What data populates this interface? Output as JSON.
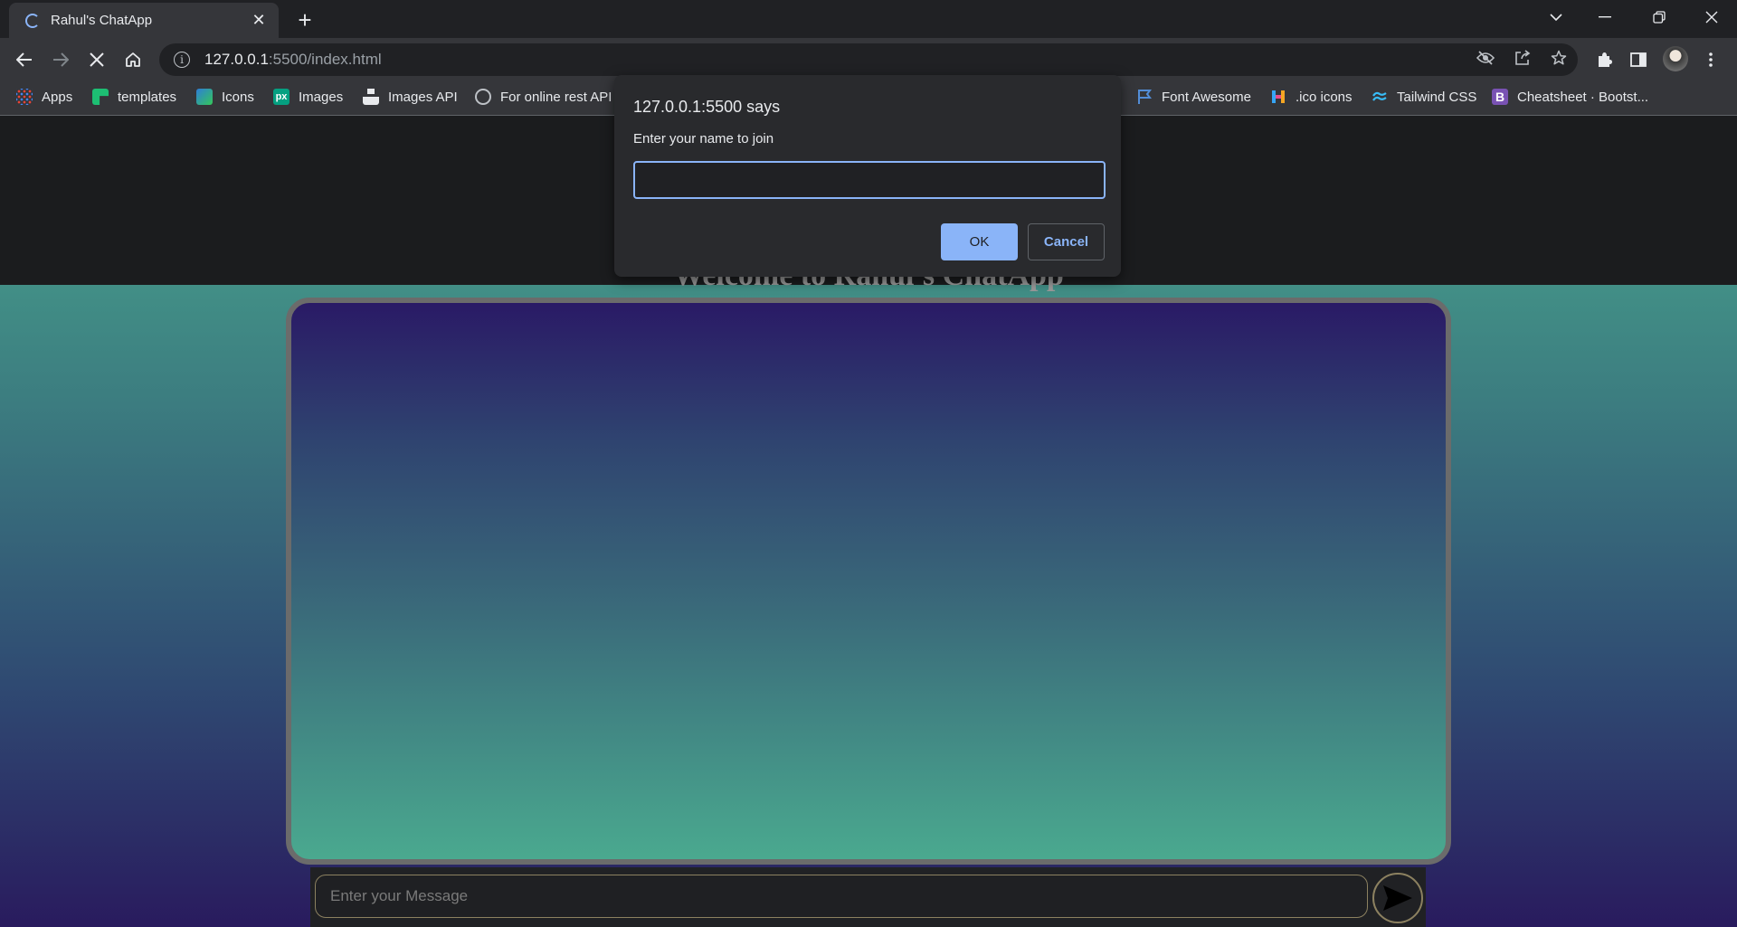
{
  "browser": {
    "tab": {
      "title": "Rahul's ChatApp",
      "favicon": "loading-spinner-icon",
      "close_glyph": "✕"
    },
    "new_tab_glyph": "+",
    "window_controls": [
      "chevron-down-icon",
      "minimize-icon",
      "restore-icon",
      "close-icon"
    ],
    "address_bar": {
      "host": "127.0.0.1",
      "path": ":5500/index.html",
      "info_icon": "info-icon"
    },
    "accent_color": "#8ab4f8"
  },
  "bookmarks": [
    {
      "label": "Apps",
      "icon": "apps-grid-icon"
    },
    {
      "label": "templates",
      "icon": "templates-icon"
    },
    {
      "label": "Icons",
      "icon": "icons-site-icon"
    },
    {
      "label": "Images",
      "icon": "pexels-icon"
    },
    {
      "label": "Images API",
      "icon": "unsplash-icon"
    },
    {
      "label": "For online rest API",
      "icon": "rest-api-icon"
    },
    {
      "label": "Font Awesome",
      "icon": "flag-icon"
    },
    {
      "label": ".ico icons",
      "icon": "ico-icon"
    },
    {
      "label": "Tailwind CSS",
      "icon": "tailwind-icon"
    },
    {
      "label": "Cheatsheet · Bootst...",
      "icon": "bootstrap-icon"
    }
  ],
  "dialog": {
    "title": "127.0.0.1:5500 says",
    "message": "Enter your name to join",
    "input_value": "",
    "ok_label": "OK",
    "cancel_label": "Cancel"
  },
  "page": {
    "heading": "Welcome to Rahul's ChatApp",
    "message_placeholder": "Enter your Message",
    "send_icon": "send-icon"
  }
}
